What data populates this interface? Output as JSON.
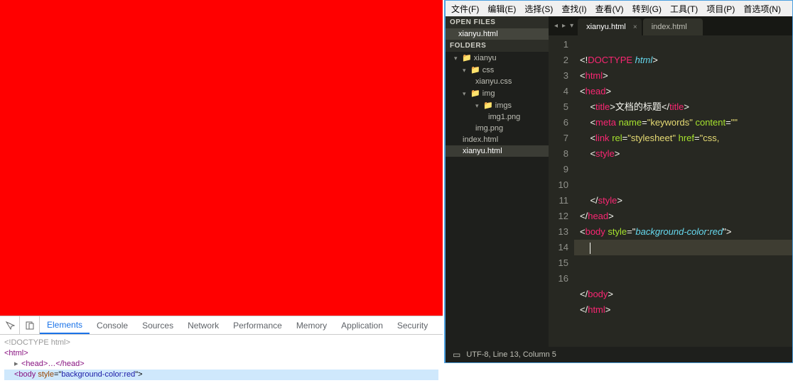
{
  "devtools": {
    "tabs": [
      "Elements",
      "Console",
      "Sources",
      "Network",
      "Performance",
      "Memory",
      "Application",
      "Security"
    ],
    "active": "Elements",
    "dom": {
      "doctype": "<!DOCTYPE html>",
      "html_open": "<html>",
      "head": "<head>…</head>",
      "body_open": "<body ",
      "body_attr": "style",
      "body_eq": "=\"",
      "body_val": "background-color:red",
      "body_close": "\">"
    }
  },
  "editor": {
    "menu": [
      "文件(F)",
      "编辑(E)",
      "选择(S)",
      "查找(I)",
      "查看(V)",
      "转到(G)",
      "工具(T)",
      "项目(P)",
      "首选项(N)"
    ],
    "open_files_header": "OPEN FILES",
    "open_files": [
      "xianyu.html"
    ],
    "folders_header": "FOLDERS",
    "tree": {
      "root": "xianyu",
      "css": "css",
      "css_file": "xianyu.css",
      "img": "img",
      "imgs": "imgs",
      "img1": "img1.png",
      "imgpng": "img.png",
      "index": "index.html",
      "xianyu": "xianyu.html"
    },
    "tabs": [
      {
        "name": "xianyu.html",
        "active": true
      },
      {
        "name": "index.html",
        "active": false
      }
    ],
    "code_lines": [
      "1",
      "2",
      "3",
      "4",
      "5",
      "6",
      "7",
      "8",
      "9",
      "10",
      "11",
      "12",
      "13",
      "14",
      "15",
      "16"
    ],
    "code": {
      "l1_a": "<!",
      "l1_b": "DOCTYPE",
      "l1_c": " html",
      "l1_d": ">",
      "l2_a": "<",
      "l2_b": "html",
      "l2_c": ">",
      "l3_a": "<",
      "l3_b": "head",
      "l3_c": ">",
      "l4_a": "    <",
      "l4_b": "title",
      "l4_c": ">",
      "l4_text": "文档的标题",
      "l4_d": "</",
      "l4_e": "title",
      "l4_f": ">",
      "l5_a": "    <",
      "l5_b": "meta",
      "l5_sp": " ",
      "l5_name": "name",
      "l5_eq": "=",
      "l5_nv": "\"keywords\"",
      "l5_sp2": " ",
      "l5_content": "content",
      "l5_eq2": "=",
      "l5_cv": "\"\"",
      "l6_a": "    <",
      "l6_b": "link",
      "l6_sp": " ",
      "l6_rel": "rel",
      "l6_eq": "=",
      "l6_rv": "\"stylesheet\"",
      "l6_sp2": " ",
      "l6_href": "href",
      "l6_eq2": "=",
      "l6_hv": "\"css,",
      "l7_a": "    <",
      "l7_b": "style",
      "l7_c": ">",
      "l10_a": "    </",
      "l10_b": "style",
      "l10_c": ">",
      "l11_a": "</",
      "l11_b": "head",
      "l11_c": ">",
      "l12_a": "<",
      "l12_b": "body",
      "l12_sp": " ",
      "l12_style": "style",
      "l12_eq": "=\"",
      "l12_prop": "background-color",
      "l12_colon": ":",
      "l12_val": "red",
      "l12_end": "\">",
      "l15_a": "</",
      "l15_b": "body",
      "l15_c": ">",
      "l16_a": "</",
      "l16_b": "html",
      "l16_c": ">"
    },
    "status": "UTF-8, Line 13, Column 5"
  }
}
